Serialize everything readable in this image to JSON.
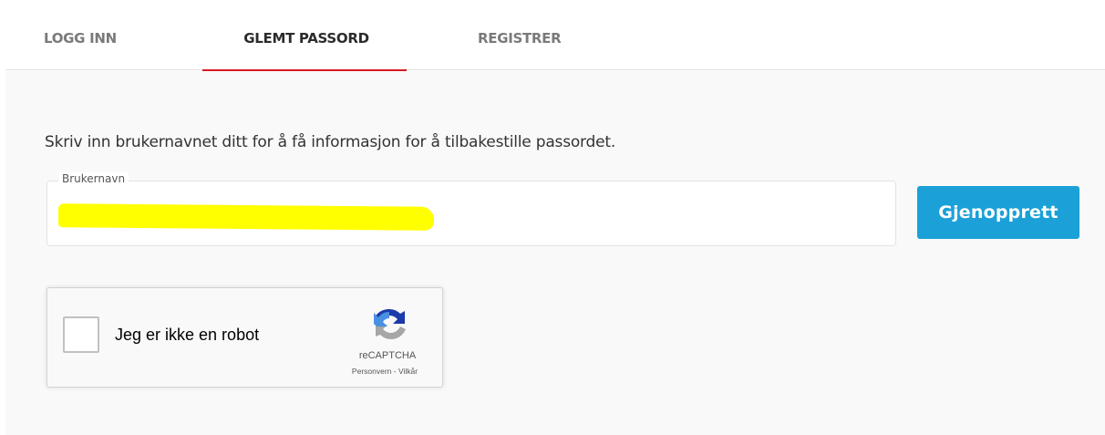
{
  "tabs": [
    {
      "label": "LOGG INN",
      "active": false
    },
    {
      "label": "GLEMT PASSORD",
      "active": true
    },
    {
      "label": "REGISTRER",
      "active": false
    }
  ],
  "form": {
    "instruction": "Skriv inn brukernavnet ditt for å få informasjon for å tilbakestille passordet.",
    "username_label": "Brukernavn",
    "username_value": "",
    "username_redacted": true,
    "submit_label": "Gjenopprett"
  },
  "captcha": {
    "checkbox_label": "Jeg er ikke en robot",
    "checked": false,
    "brand": "reCAPTCHA",
    "privacy_link": "Personvern",
    "separator": " - ",
    "terms_link": "Vilkår"
  },
  "colors": {
    "accent_tab": "#d71920",
    "button": "#1ba1d8",
    "redaction": "#ffff00"
  }
}
